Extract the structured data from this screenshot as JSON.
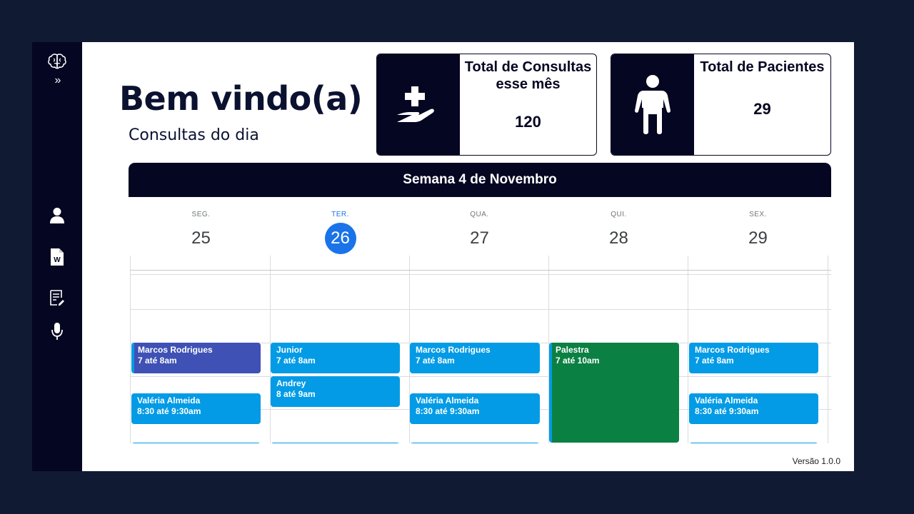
{
  "sidebar": {
    "expand_label": "»",
    "icons": [
      "brain-icon",
      "user-icon",
      "word-document-icon",
      "edit-notes-icon",
      "microphone-icon"
    ]
  },
  "header": {
    "welcome": "Bem vindo(a)",
    "subtitle": "Consultas do dia"
  },
  "stats": {
    "consultas": {
      "label_line1": "Total de Consultas",
      "label_line2": "esse mês",
      "value": "120",
      "icon": "medical-hand-icon"
    },
    "pacientes": {
      "label": "Total de Pacientes",
      "value": "29",
      "icon": "person-icon"
    }
  },
  "calendar": {
    "title": "Semana 4 de Novembro",
    "days": [
      {
        "dow": "SEG.",
        "num": "25"
      },
      {
        "dow": "TER.",
        "num": "26",
        "today": true
      },
      {
        "dow": "QUA.",
        "num": "27"
      },
      {
        "dow": "QUI.",
        "num": "28"
      },
      {
        "dow": "SEX.",
        "num": "29"
      }
    ],
    "events": [
      {
        "title": "Marcos Rodrigues",
        "time": "7 até 8am"
      },
      {
        "title": "Valéria Almeida",
        "time": "8:30 até 9:30am"
      },
      {
        "title": "Junior",
        "time": "7 até 8am"
      },
      {
        "title": "Andrey",
        "time": "8 até 9am"
      },
      {
        "title": "Marcos Rodrigues",
        "time": "7 até 8am"
      },
      {
        "title": "Valéria Almeida",
        "time": "8:30 até 9:30am"
      },
      {
        "title": "Palestra",
        "time": "7 até 10am"
      },
      {
        "title": "Marcos Rodrigues",
        "time": "7 até 8am"
      },
      {
        "title": "Valéria Almeida",
        "time": "8:30 até 9:30am"
      }
    ],
    "colors": {
      "blue": "#039be5",
      "purple": "#3f51b5",
      "green": "#0b8043",
      "today": "#1a73e8"
    }
  },
  "footer": {
    "version": "Versão 1.0.0"
  }
}
